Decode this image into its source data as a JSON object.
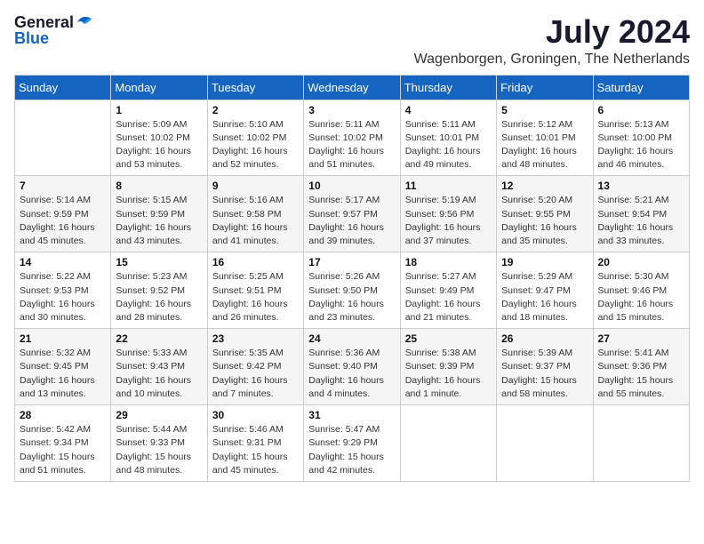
{
  "logo": {
    "general": "General",
    "blue": "Blue"
  },
  "title": "July 2024",
  "location": "Wagenborgen, Groningen, The Netherlands",
  "weekdays": [
    "Sunday",
    "Monday",
    "Tuesday",
    "Wednesday",
    "Thursday",
    "Friday",
    "Saturday"
  ],
  "weeks": [
    [
      {
        "day": "",
        "info": ""
      },
      {
        "day": "1",
        "info": "Sunrise: 5:09 AM\nSunset: 10:02 PM\nDaylight: 16 hours\nand 53 minutes."
      },
      {
        "day": "2",
        "info": "Sunrise: 5:10 AM\nSunset: 10:02 PM\nDaylight: 16 hours\nand 52 minutes."
      },
      {
        "day": "3",
        "info": "Sunrise: 5:11 AM\nSunset: 10:02 PM\nDaylight: 16 hours\nand 51 minutes."
      },
      {
        "day": "4",
        "info": "Sunrise: 5:11 AM\nSunset: 10:01 PM\nDaylight: 16 hours\nand 49 minutes."
      },
      {
        "day": "5",
        "info": "Sunrise: 5:12 AM\nSunset: 10:01 PM\nDaylight: 16 hours\nand 48 minutes."
      },
      {
        "day": "6",
        "info": "Sunrise: 5:13 AM\nSunset: 10:00 PM\nDaylight: 16 hours\nand 46 minutes."
      }
    ],
    [
      {
        "day": "7",
        "info": "Sunrise: 5:14 AM\nSunset: 9:59 PM\nDaylight: 16 hours\nand 45 minutes."
      },
      {
        "day": "8",
        "info": "Sunrise: 5:15 AM\nSunset: 9:59 PM\nDaylight: 16 hours\nand 43 minutes."
      },
      {
        "day": "9",
        "info": "Sunrise: 5:16 AM\nSunset: 9:58 PM\nDaylight: 16 hours\nand 41 minutes."
      },
      {
        "day": "10",
        "info": "Sunrise: 5:17 AM\nSunset: 9:57 PM\nDaylight: 16 hours\nand 39 minutes."
      },
      {
        "day": "11",
        "info": "Sunrise: 5:19 AM\nSunset: 9:56 PM\nDaylight: 16 hours\nand 37 minutes."
      },
      {
        "day": "12",
        "info": "Sunrise: 5:20 AM\nSunset: 9:55 PM\nDaylight: 16 hours\nand 35 minutes."
      },
      {
        "day": "13",
        "info": "Sunrise: 5:21 AM\nSunset: 9:54 PM\nDaylight: 16 hours\nand 33 minutes."
      }
    ],
    [
      {
        "day": "14",
        "info": "Sunrise: 5:22 AM\nSunset: 9:53 PM\nDaylight: 16 hours\nand 30 minutes."
      },
      {
        "day": "15",
        "info": "Sunrise: 5:23 AM\nSunset: 9:52 PM\nDaylight: 16 hours\nand 28 minutes."
      },
      {
        "day": "16",
        "info": "Sunrise: 5:25 AM\nSunset: 9:51 PM\nDaylight: 16 hours\nand 26 minutes."
      },
      {
        "day": "17",
        "info": "Sunrise: 5:26 AM\nSunset: 9:50 PM\nDaylight: 16 hours\nand 23 minutes."
      },
      {
        "day": "18",
        "info": "Sunrise: 5:27 AM\nSunset: 9:49 PM\nDaylight: 16 hours\nand 21 minutes."
      },
      {
        "day": "19",
        "info": "Sunrise: 5:29 AM\nSunset: 9:47 PM\nDaylight: 16 hours\nand 18 minutes."
      },
      {
        "day": "20",
        "info": "Sunrise: 5:30 AM\nSunset: 9:46 PM\nDaylight: 16 hours\nand 15 minutes."
      }
    ],
    [
      {
        "day": "21",
        "info": "Sunrise: 5:32 AM\nSunset: 9:45 PM\nDaylight: 16 hours\nand 13 minutes."
      },
      {
        "day": "22",
        "info": "Sunrise: 5:33 AM\nSunset: 9:43 PM\nDaylight: 16 hours\nand 10 minutes."
      },
      {
        "day": "23",
        "info": "Sunrise: 5:35 AM\nSunset: 9:42 PM\nDaylight: 16 hours\nand 7 minutes."
      },
      {
        "day": "24",
        "info": "Sunrise: 5:36 AM\nSunset: 9:40 PM\nDaylight: 16 hours\nand 4 minutes."
      },
      {
        "day": "25",
        "info": "Sunrise: 5:38 AM\nSunset: 9:39 PM\nDaylight: 16 hours\nand 1 minute."
      },
      {
        "day": "26",
        "info": "Sunrise: 5:39 AM\nSunset: 9:37 PM\nDaylight: 15 hours\nand 58 minutes."
      },
      {
        "day": "27",
        "info": "Sunrise: 5:41 AM\nSunset: 9:36 PM\nDaylight: 15 hours\nand 55 minutes."
      }
    ],
    [
      {
        "day": "28",
        "info": "Sunrise: 5:42 AM\nSunset: 9:34 PM\nDaylight: 15 hours\nand 51 minutes."
      },
      {
        "day": "29",
        "info": "Sunrise: 5:44 AM\nSunset: 9:33 PM\nDaylight: 15 hours\nand 48 minutes."
      },
      {
        "day": "30",
        "info": "Sunrise: 5:46 AM\nSunset: 9:31 PM\nDaylight: 15 hours\nand 45 minutes."
      },
      {
        "day": "31",
        "info": "Sunrise: 5:47 AM\nSunset: 9:29 PM\nDaylight: 15 hours\nand 42 minutes."
      },
      {
        "day": "",
        "info": ""
      },
      {
        "day": "",
        "info": ""
      },
      {
        "day": "",
        "info": ""
      }
    ]
  ]
}
